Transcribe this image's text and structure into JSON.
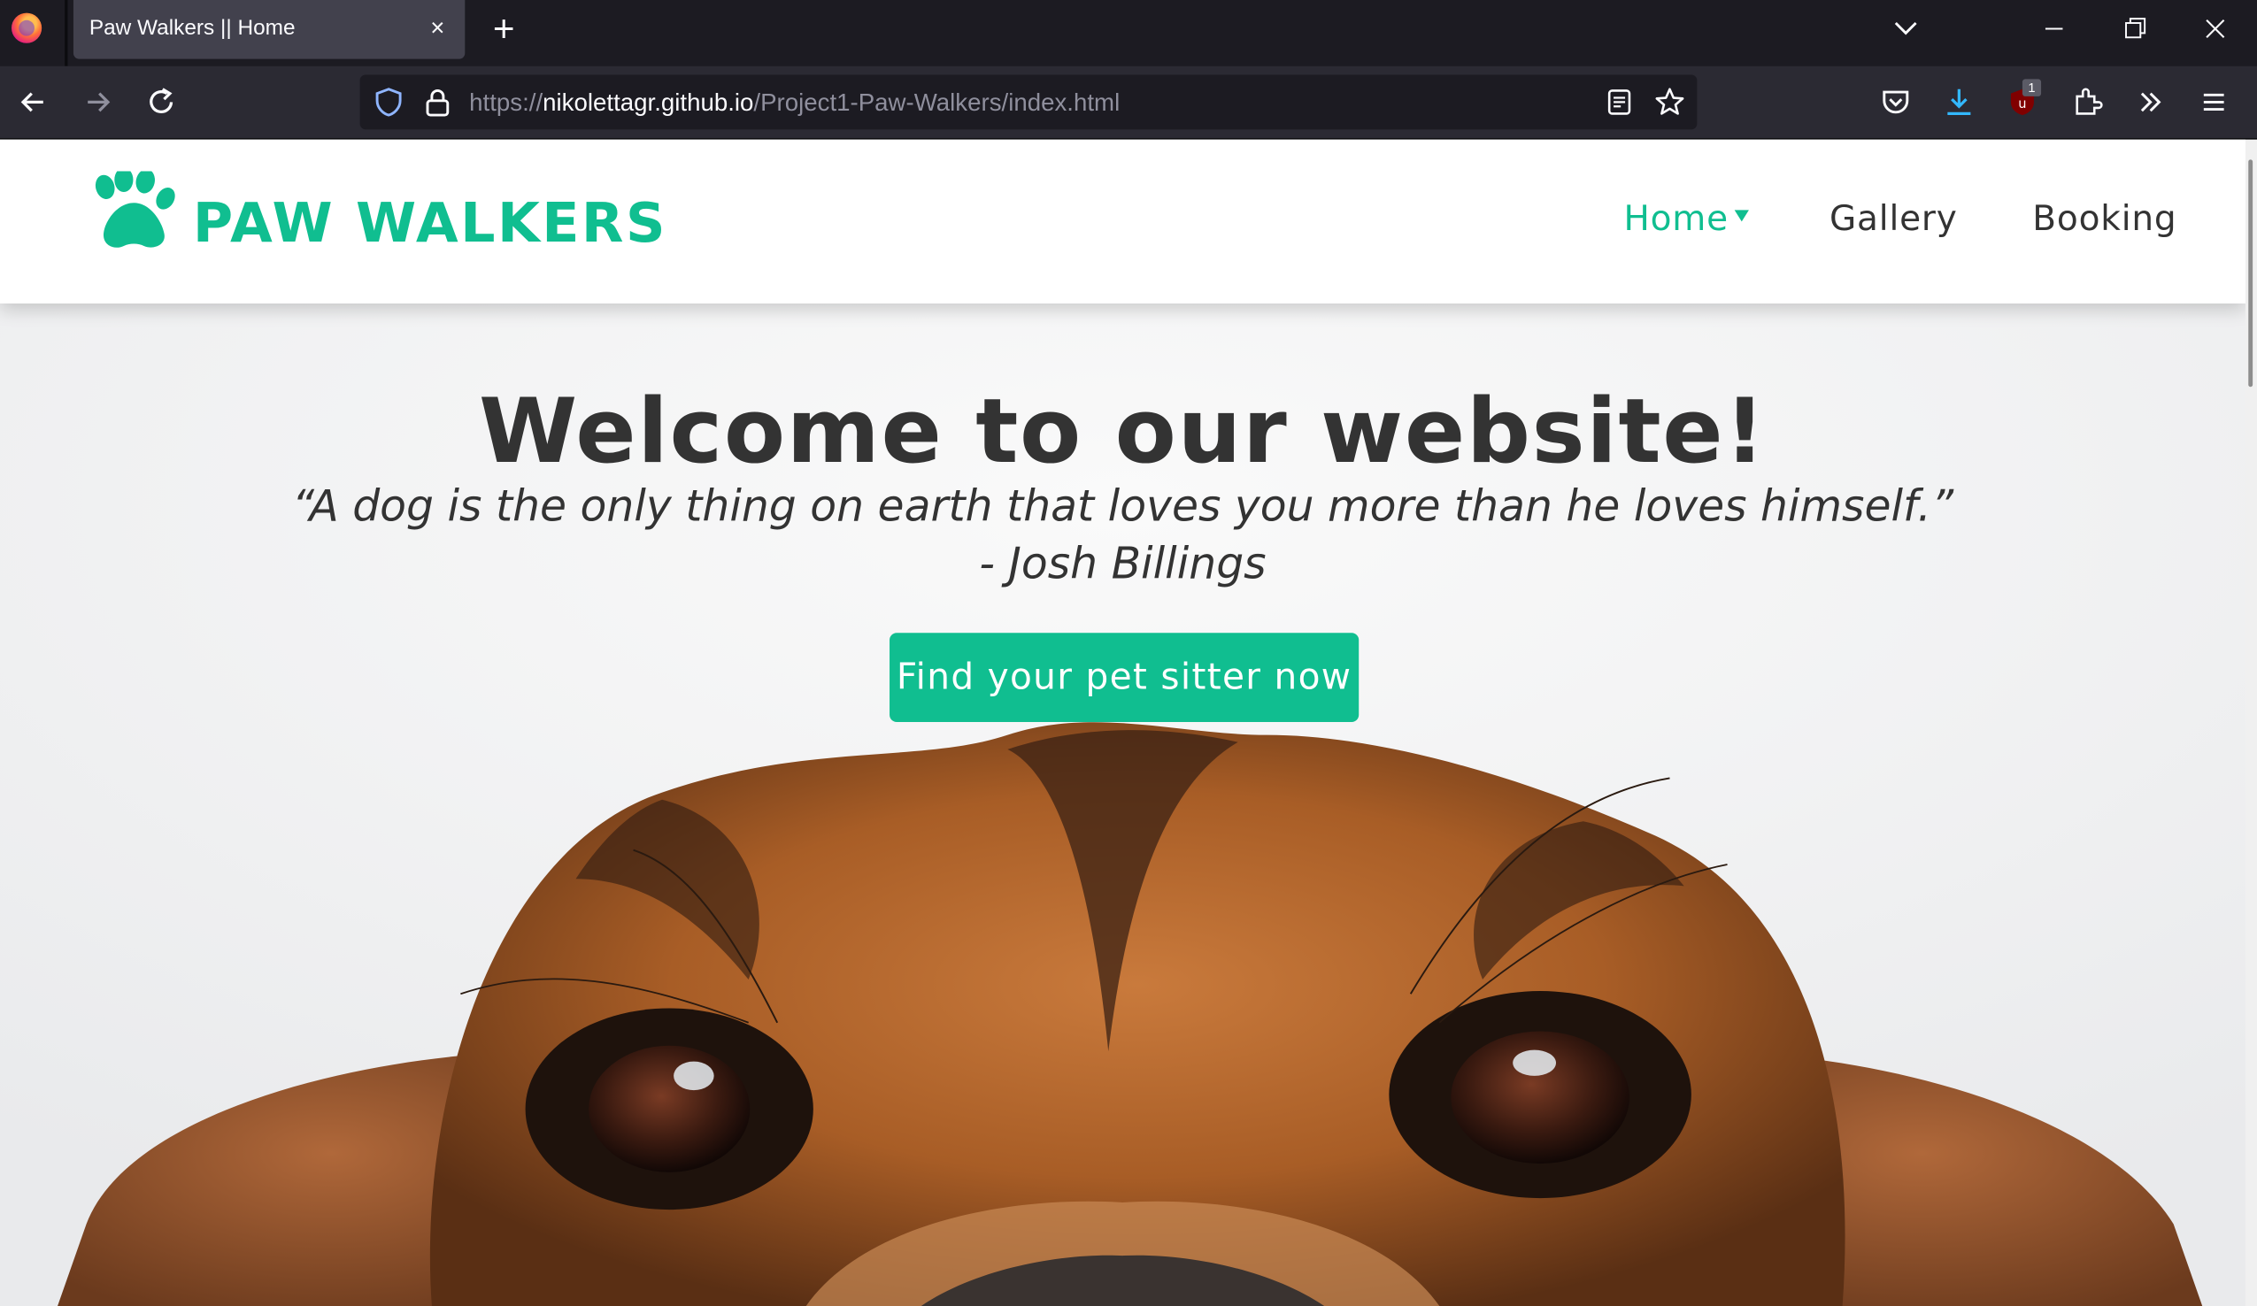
{
  "browser": {
    "tab_title": "Paw Walkers || Home",
    "tab_close_icon": "×",
    "new_tab_icon": "+",
    "url_scheme": "https://",
    "url_host": "nikolettagr.github.io",
    "url_path": "/Project1-Paw-Walkers/index.html",
    "extension_badge": "1"
  },
  "site": {
    "brand": "PAW WALKERS",
    "brand_color": "#10be90",
    "menu": {
      "home": "Home",
      "gallery": "Gallery",
      "booking": "Booking"
    }
  },
  "hero": {
    "title": "Welcome to our website!",
    "quote": "“A dog is the only thing on earth that loves you more than he loves himself.”",
    "author": "- Josh Billings",
    "cta_label": "Find your pet sitter now"
  }
}
